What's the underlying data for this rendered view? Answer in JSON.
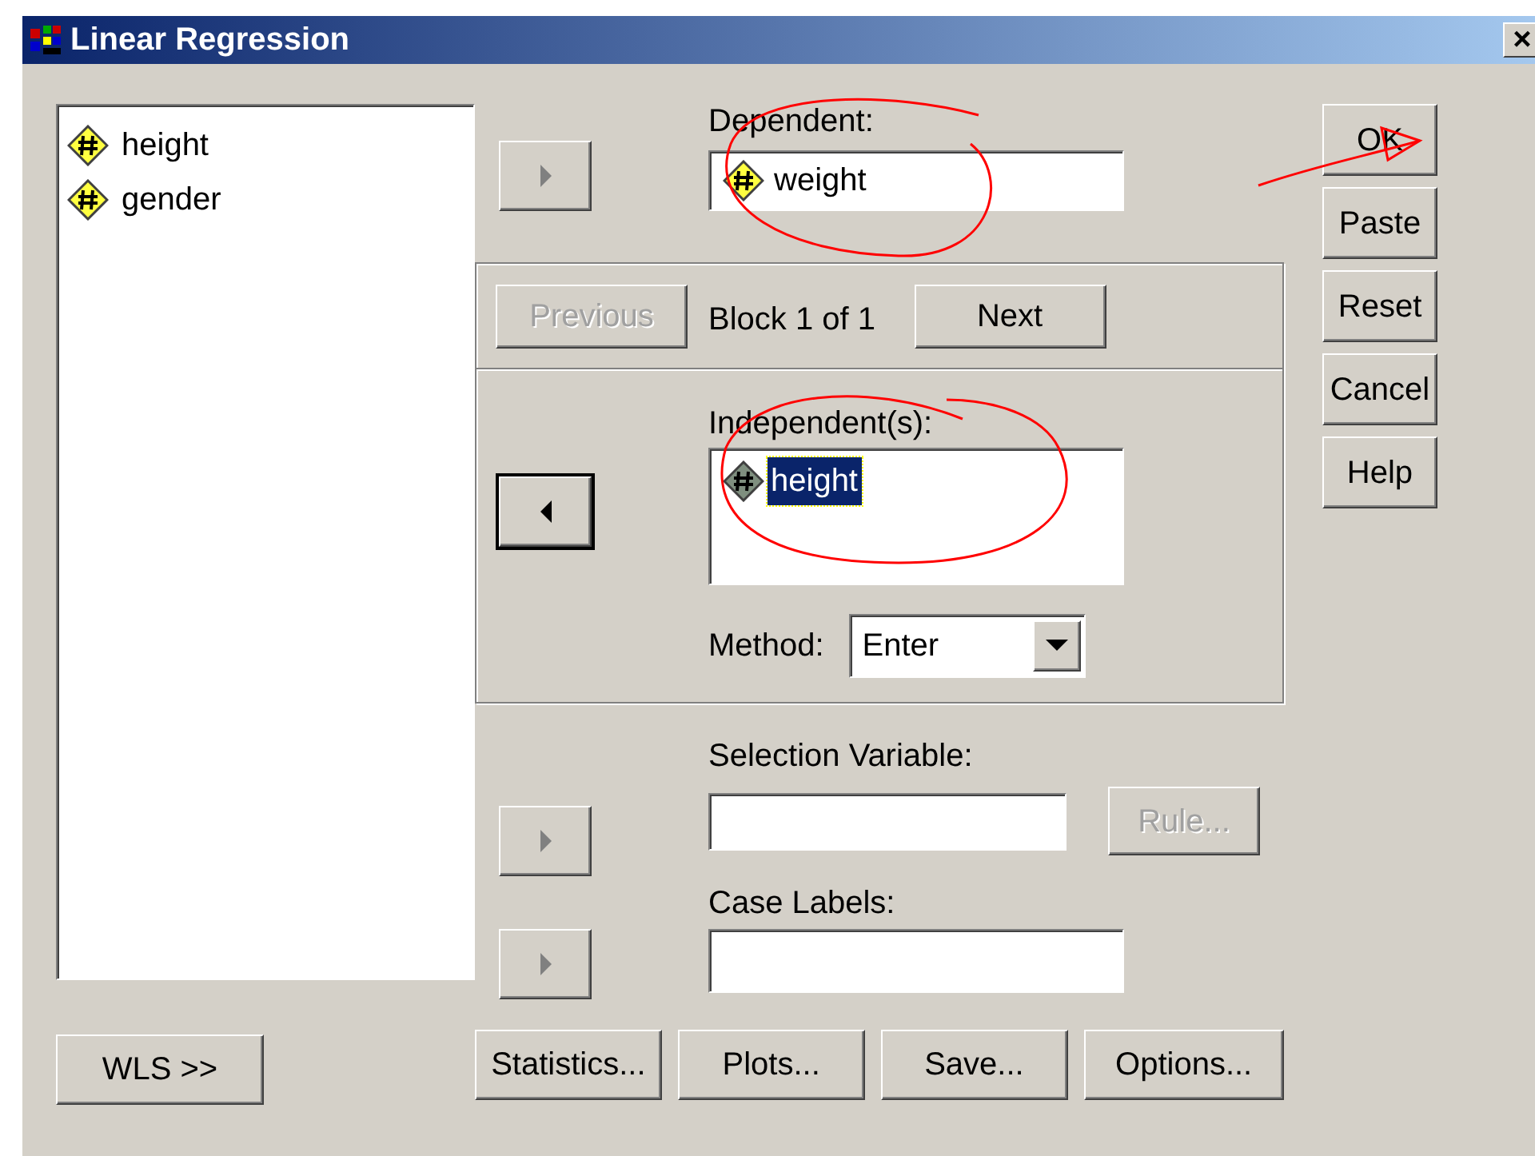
{
  "window": {
    "title": "Linear Regression",
    "close": "×"
  },
  "variables": [
    {
      "name": "height",
      "selected": false
    },
    {
      "name": "gender",
      "selected": false
    }
  ],
  "move_buttons": [
    {
      "kind": "right",
      "disabled": true,
      "default": false
    },
    {
      "kind": "left",
      "disabled": false,
      "default": true
    },
    {
      "kind": "right",
      "disabled": true,
      "default": false
    },
    {
      "kind": "right",
      "disabled": true,
      "default": false
    }
  ],
  "dependent": {
    "label": "Dependent:",
    "value": "weight"
  },
  "block": {
    "previous": {
      "label": "Previous",
      "disabled": true
    },
    "caption": "Block 1 of 1",
    "next": {
      "label": "Next",
      "disabled": false
    }
  },
  "independents": {
    "label": "Independent(s):",
    "items": [
      {
        "name": "height",
        "selected": true
      }
    ]
  },
  "method": {
    "label": "Method:",
    "value": "Enter"
  },
  "selection_variable": {
    "label": "Selection Variable:",
    "rule": {
      "label": "Rule...",
      "disabled": true
    }
  },
  "case_labels": {
    "label": "Case Labels:"
  },
  "side_buttons": [
    {
      "label": "OK"
    },
    {
      "label": "Paste"
    },
    {
      "label": "Reset"
    },
    {
      "label": "Cancel"
    },
    {
      "label": "Help"
    }
  ],
  "wls_button": {
    "label": "WLS >>"
  },
  "bottom_buttons": [
    {
      "label": "Statistics..."
    },
    {
      "label": "Plots..."
    },
    {
      "label": "Save..."
    },
    {
      "label": "Options..."
    }
  ],
  "annotations": [
    {
      "kind": "circle",
      "color": "#ff0000"
    },
    {
      "kind": "circle",
      "color": "#ff0000"
    },
    {
      "kind": "arrow",
      "color": "#ff0000"
    }
  ]
}
